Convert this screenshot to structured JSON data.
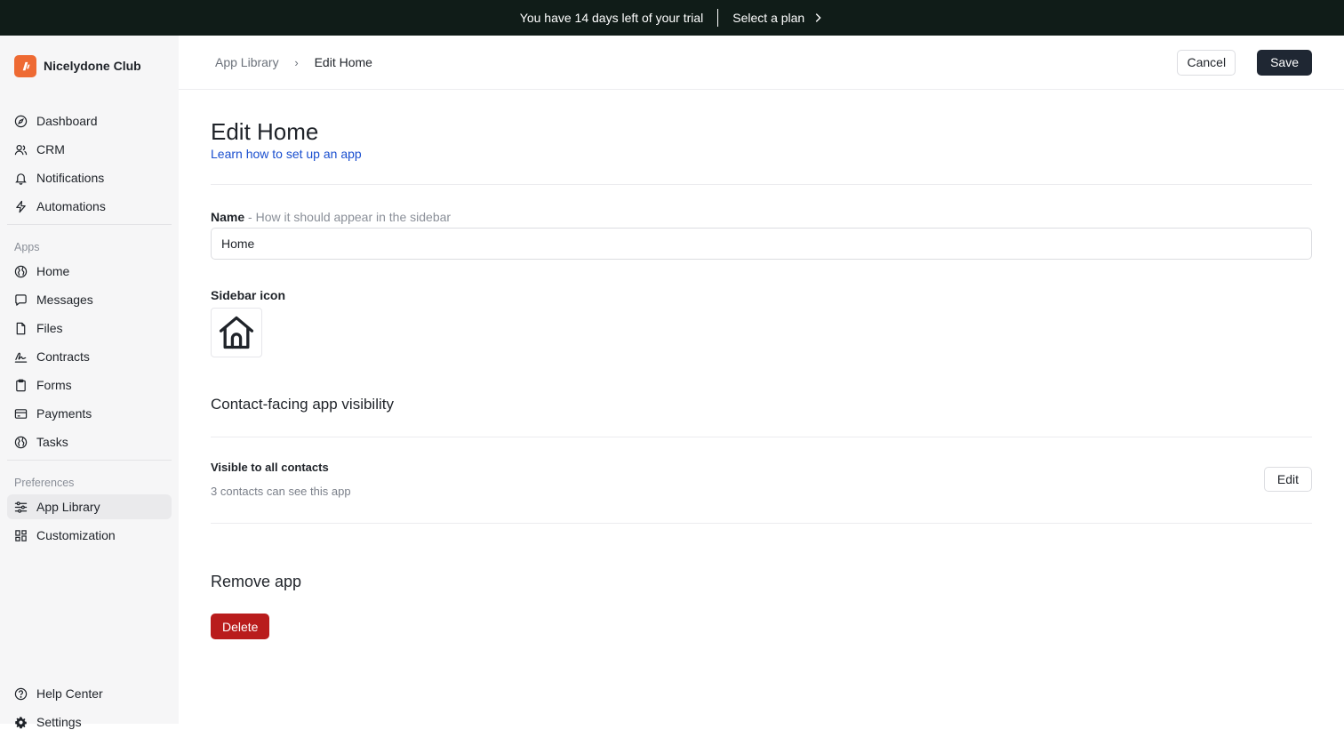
{
  "banner": {
    "trial_text": "You have 14 days left of your trial",
    "plan_link": "Select a plan",
    "background": "#101c18"
  },
  "sidebar": {
    "brand_name": "Nicelydone Club",
    "brand_color": "#ee6a33",
    "main_items": [
      {
        "label": "Dashboard",
        "icon": "compass-icon"
      },
      {
        "label": "CRM",
        "icon": "users-icon"
      },
      {
        "label": "Notifications",
        "icon": "bell-icon"
      },
      {
        "label": "Automations",
        "icon": "bolt-icon"
      }
    ],
    "apps_heading": "Apps",
    "app_items": [
      {
        "label": "Home",
        "icon": "globe-icon"
      },
      {
        "label": "Messages",
        "icon": "chat-icon"
      },
      {
        "label": "Files",
        "icon": "file-icon"
      },
      {
        "label": "Contracts",
        "icon": "signature-icon"
      },
      {
        "label": "Forms",
        "icon": "clipboard-icon"
      },
      {
        "label": "Payments",
        "icon": "credit-card-icon"
      },
      {
        "label": "Tasks",
        "icon": "globe-icon"
      }
    ],
    "preferences_heading": "Preferences",
    "preference_items": [
      {
        "label": "App Library",
        "icon": "sliders-icon",
        "active": true
      },
      {
        "label": "Customization",
        "icon": "grid-icon"
      }
    ],
    "bottom_items": [
      {
        "label": "Help Center",
        "icon": "help-icon"
      },
      {
        "label": "Settings",
        "icon": "gear-icon"
      }
    ]
  },
  "topbar": {
    "breadcrumb_parent": "App Library",
    "breadcrumb_current": "Edit Home",
    "cancel_label": "Cancel",
    "save_label": "Save"
  },
  "page": {
    "title": "Edit Home",
    "learn_link": "Learn how to set up an app",
    "name_label": "Name",
    "name_hint": "- How it should appear in the sidebar",
    "name_value": "Home",
    "sidebar_icon_label": "Sidebar icon",
    "sidebar_icon": "house-icon",
    "visibility_heading": "Contact-facing app visibility",
    "visibility_title": "Visible to all contacts",
    "visibility_subtitle": "3 contacts can see this app",
    "edit_label": "Edit",
    "remove_heading": "Remove app",
    "delete_label": "Delete",
    "delete_color": "#b91c1c",
    "link_color": "#1a4fcf"
  }
}
